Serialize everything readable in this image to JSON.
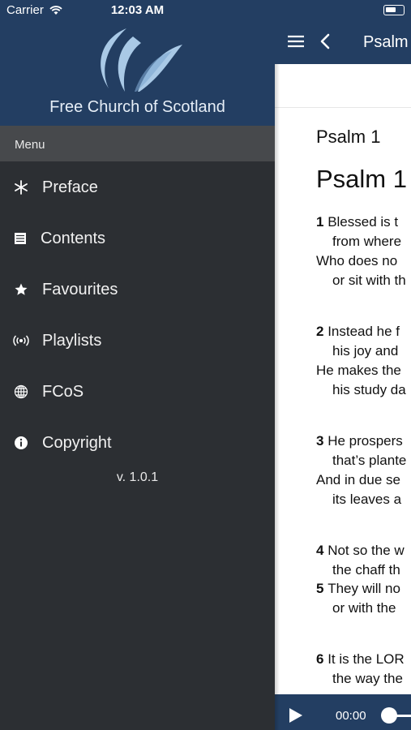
{
  "status_bar": {
    "carrier": "Carrier",
    "time": "12:03 AM"
  },
  "drawer": {
    "organization": "Free Church of Scotland",
    "menu_header": "Menu",
    "items": [
      {
        "label": "Preface",
        "icon": "asterisk-icon"
      },
      {
        "label": "Contents",
        "icon": "list-icon"
      },
      {
        "label": "Favourites",
        "icon": "star-icon"
      },
      {
        "label": "Playlists",
        "icon": "broadcast-icon"
      },
      {
        "label": "FCoS",
        "icon": "globe-icon"
      },
      {
        "label": "Copyright",
        "icon": "info-icon"
      }
    ],
    "version": "v. 1.0.1"
  },
  "content": {
    "nav_title": "Psalm",
    "psalm_label": "Psalm 1",
    "psalm_heading": "Psalm 1",
    "lines": [
      {
        "num": "1",
        "text": "Blessed is t"
      },
      {
        "num": "",
        "text": "from where"
      },
      {
        "num": "",
        "text": "Who does no"
      },
      {
        "num": "",
        "text": "or sit with th"
      },
      {
        "num": "2",
        "text": "Instead he f"
      },
      {
        "num": "",
        "text": "his joy and"
      },
      {
        "num": "",
        "text": "He makes the"
      },
      {
        "num": "",
        "text": "his study da"
      },
      {
        "num": "3",
        "text": "He prospers"
      },
      {
        "num": "",
        "text": "that’s plante"
      },
      {
        "num": "",
        "text": "And in due se"
      },
      {
        "num": "",
        "text": "its leaves a"
      },
      {
        "num": "4",
        "text": "Not so the w"
      },
      {
        "num": "",
        "text": "the chaff th"
      },
      {
        "num": "5",
        "text": "They will no"
      },
      {
        "num": "",
        "text": "or with the"
      },
      {
        "num": "6",
        "text": "It is the LOR"
      },
      {
        "num": "",
        "text": "the way the"
      }
    ]
  },
  "player": {
    "time": "00:00"
  },
  "colors": {
    "header_blue": "#233e62",
    "drawer_bg": "#2c2f33",
    "menu_bar": "#47494c"
  }
}
